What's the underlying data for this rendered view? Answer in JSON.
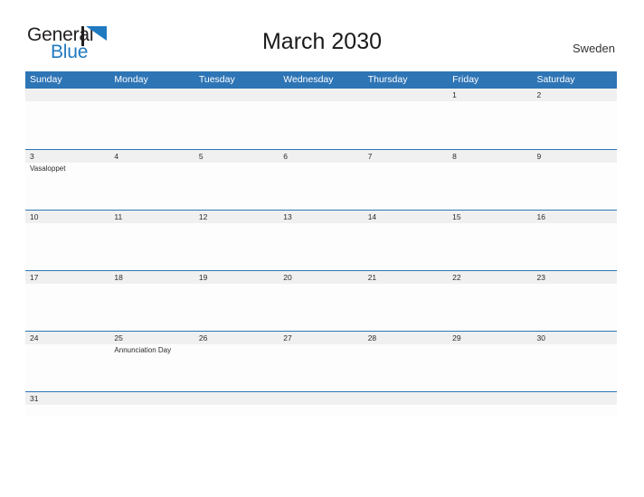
{
  "brand": {
    "name_part1": "General",
    "name_part2": "Blue",
    "mark_icon": "flag-triangle-icon",
    "color_primary": "#1f7ac0",
    "color_text": "#231f20"
  },
  "header": {
    "title": "March 2030",
    "country": "Sweden"
  },
  "calendar": {
    "header_color": "#2e75b6",
    "number_band_color": "#f0f0f0",
    "cell_body_color": "#fdfdfd",
    "weekdays": [
      "Sunday",
      "Monday",
      "Tuesday",
      "Wednesday",
      "Thursday",
      "Friday",
      "Saturday"
    ],
    "weeks": [
      {
        "size": "tall",
        "days": [
          {
            "number": "",
            "event": ""
          },
          {
            "number": "",
            "event": ""
          },
          {
            "number": "",
            "event": ""
          },
          {
            "number": "",
            "event": ""
          },
          {
            "number": "",
            "event": ""
          },
          {
            "number": "1",
            "event": ""
          },
          {
            "number": "2",
            "event": ""
          }
        ]
      },
      {
        "size": "tall",
        "days": [
          {
            "number": "3",
            "event": "Vasaloppet"
          },
          {
            "number": "4",
            "event": ""
          },
          {
            "number": "5",
            "event": ""
          },
          {
            "number": "6",
            "event": ""
          },
          {
            "number": "7",
            "event": ""
          },
          {
            "number": "8",
            "event": ""
          },
          {
            "number": "9",
            "event": ""
          }
        ]
      },
      {
        "size": "tall",
        "days": [
          {
            "number": "10",
            "event": ""
          },
          {
            "number": "11",
            "event": ""
          },
          {
            "number": "12",
            "event": ""
          },
          {
            "number": "13",
            "event": ""
          },
          {
            "number": "14",
            "event": ""
          },
          {
            "number": "15",
            "event": ""
          },
          {
            "number": "16",
            "event": ""
          }
        ]
      },
      {
        "size": "tall",
        "days": [
          {
            "number": "17",
            "event": ""
          },
          {
            "number": "18",
            "event": ""
          },
          {
            "number": "19",
            "event": ""
          },
          {
            "number": "20",
            "event": ""
          },
          {
            "number": "21",
            "event": ""
          },
          {
            "number": "22",
            "event": ""
          },
          {
            "number": "23",
            "event": ""
          }
        ]
      },
      {
        "size": "tall",
        "days": [
          {
            "number": "24",
            "event": ""
          },
          {
            "number": "25",
            "event": "Annunciation Day"
          },
          {
            "number": "26",
            "event": ""
          },
          {
            "number": "27",
            "event": ""
          },
          {
            "number": "28",
            "event": ""
          },
          {
            "number": "29",
            "event": ""
          },
          {
            "number": "30",
            "event": ""
          }
        ]
      },
      {
        "size": "short",
        "days": [
          {
            "number": "31",
            "event": ""
          },
          {
            "number": "",
            "event": ""
          },
          {
            "number": "",
            "event": ""
          },
          {
            "number": "",
            "event": ""
          },
          {
            "number": "",
            "event": ""
          },
          {
            "number": "",
            "event": ""
          },
          {
            "number": "",
            "event": ""
          }
        ]
      }
    ]
  }
}
